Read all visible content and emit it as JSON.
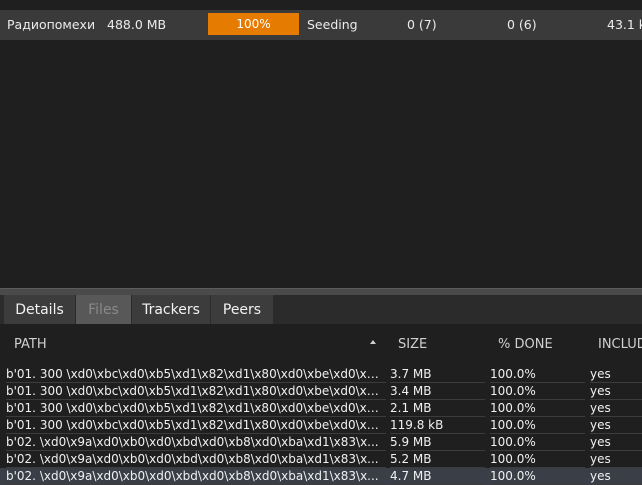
{
  "torrent": {
    "name": "Радиопомехи",
    "size": "488.0 MB",
    "progress_label": "100%",
    "progress_fraction": 1.0,
    "status": "Seeding",
    "seeds": "0 (7)",
    "peers": "0 (6)",
    "speed": "43.1 k"
  },
  "colors": {
    "progress": "#e57b00",
    "background": "#1f1f1f",
    "row": "#3a3a3a"
  },
  "tabs": [
    {
      "label": "Details"
    },
    {
      "label": "Files"
    },
    {
      "label": "Trackers"
    },
    {
      "label": "Peers"
    }
  ],
  "files": {
    "headers": {
      "path": "PATH",
      "size": "SIZE",
      "done": "% DONE",
      "include": "INCLUD"
    },
    "sort_icon": "sort-ascending-icon",
    "rows": [
      {
        "path": "b'01. 300 \\xd0\\xbc\\xd0\\xb5\\xd1\\x82\\xd1\\x80\\xd0\\xbe\\xd0\\xb2...",
        "size": "3.7 MB",
        "done": "100.0%",
        "include": "yes"
      },
      {
        "path": "b'01. 300 \\xd0\\xbc\\xd0\\xb5\\xd1\\x82\\xd1\\x80\\xd0\\xbe\\xd0\\xb2...",
        "size": "3.4 MB",
        "done": "100.0%",
        "include": "yes"
      },
      {
        "path": "b'01. 300 \\xd0\\xbc\\xd0\\xb5\\xd1\\x82\\xd1\\x80\\xd0\\xbe\\xd0\\xb2...",
        "size": "2.1 MB",
        "done": "100.0%",
        "include": "yes"
      },
      {
        "path": "b'01. 300 \\xd0\\xbc\\xd0\\xb5\\xd1\\x82\\xd1\\x80\\xd0\\xbe\\xd0\\xb2...",
        "size": "119.8 kB",
        "done": "100.0%",
        "include": "yes"
      },
      {
        "path": "b'02. \\xd0\\x9a\\xd0\\xb0\\xd0\\xbd\\xd0\\xb8\\xd0\\xba\\xd1\\x83\\x...",
        "size": "5.9 MB",
        "done": "100.0%",
        "include": "yes"
      },
      {
        "path": "b'02. \\xd0\\x9a\\xd0\\xb0\\xd0\\xbd\\xd0\\xb8\\xd0\\xba\\xd1\\x83\\x...",
        "size": "5.2 MB",
        "done": "100.0%",
        "include": "yes"
      },
      {
        "path": "b'02. \\xd0\\x9a\\xd0\\xb0\\xd0\\xbd\\xd0\\xb8\\xd0\\xba\\xd1\\x83\\x...",
        "size": "4.7 MB",
        "done": "100.0%",
        "include": "yes"
      }
    ]
  }
}
